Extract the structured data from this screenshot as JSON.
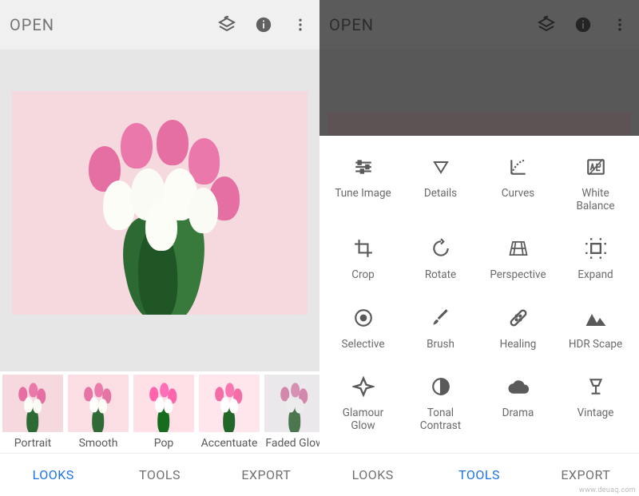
{
  "left": {
    "open_label": "OPEN",
    "looks": [
      {
        "label": "Portrait"
      },
      {
        "label": "Smooth"
      },
      {
        "label": "Pop"
      },
      {
        "label": "Accentuate"
      },
      {
        "label": "Faded Glow"
      }
    ],
    "nav": {
      "looks": "LOOKS",
      "tools": "TOOLS",
      "export": "EXPORT",
      "active": "LOOKS"
    }
  },
  "right": {
    "open_label": "OPEN",
    "nav": {
      "looks": "LOOKS",
      "tools": "TOOLS",
      "export": "EXPORT",
      "active": "TOOLS"
    },
    "tools": [
      {
        "label": "Tune Image"
      },
      {
        "label": "Details"
      },
      {
        "label": "Curves"
      },
      {
        "label": "White\nBalance"
      },
      {
        "label": "Crop"
      },
      {
        "label": "Rotate"
      },
      {
        "label": "Perspective"
      },
      {
        "label": "Expand"
      },
      {
        "label": "Selective"
      },
      {
        "label": "Brush"
      },
      {
        "label": "Healing"
      },
      {
        "label": "HDR Scape"
      },
      {
        "label": "Glamour\nGlow"
      },
      {
        "label": "Tonal\nContrast"
      },
      {
        "label": "Drama"
      },
      {
        "label": "Vintage"
      }
    ]
  },
  "watermark": "www.deuaq.com"
}
